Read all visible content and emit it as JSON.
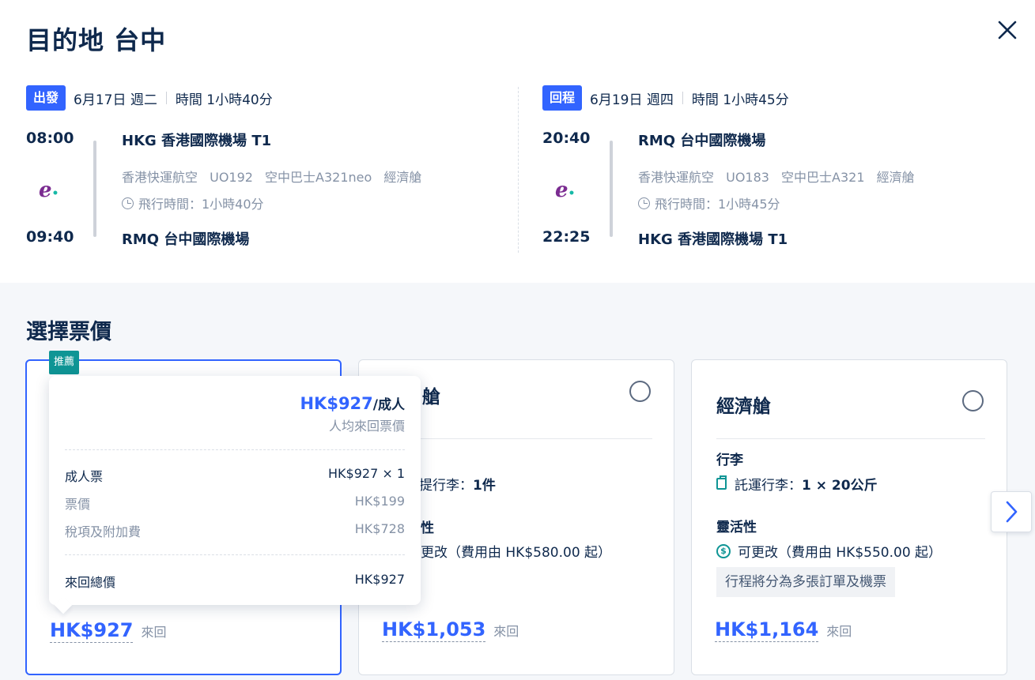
{
  "title": "目的地 台中",
  "outbound": {
    "badge": "出發",
    "date": "6月17日 週二",
    "duration_head": "時間 1小時40分",
    "depart_time": "08:00",
    "arrive_time": "09:40",
    "depart_airport": "HKG 香港國際機場 T1",
    "arrive_airport": "RMQ 台中國際機場",
    "airline": "香港快運航空",
    "flight_no": "UO192",
    "aircraft": "空中巴士A321neo",
    "cabin": "經濟艙",
    "flight_time": "飛行時間：1小時40分"
  },
  "return": {
    "badge": "回程",
    "date": "6月19日 週四",
    "duration_head": "時間 1小時45分",
    "depart_time": "20:40",
    "arrive_time": "22:25",
    "depart_airport": "RMQ 台中國際機場",
    "arrive_airport": "HKG 香港國際機場 T1",
    "airline": "香港快運航空",
    "flight_no": "UO183",
    "aircraft": "空中巴士A321",
    "cabin": "經濟艙",
    "flight_time": "飛行時間：1小時45分"
  },
  "airline_logo_text": "e",
  "fare_section": {
    "title": "選擇票價",
    "cards": [
      {
        "badge": "推薦",
        "price": "HK$927",
        "price_unit": "來回"
      },
      {
        "title_partial": "艙",
        "baggage": "提行李：",
        "baggage_value": "1件",
        "flex_partial": "性",
        "change": "更改（費用由 HK$580.00 起）",
        "price": "HK$1,053",
        "price_unit": "來回"
      },
      {
        "title": "經濟艙",
        "baggage_head": "行李",
        "baggage": "託運行李：",
        "baggage_value": "1 × 20公斤",
        "flex_head": "靈活性",
        "change": "可更改（費用由 HK$550.00 起）",
        "note": "行程將分為多張訂單及機票",
        "price": "HK$1,164",
        "price_unit": "來回"
      }
    ]
  },
  "tooltip": {
    "price": "HK$927",
    "per": "/成人",
    "sub": "人均來回票價",
    "rows": [
      {
        "label": "成人票",
        "value": "HK$927 × 1"
      },
      {
        "label": "票價",
        "value": "HK$199"
      },
      {
        "label": "稅項及附加費",
        "value": "HK$728"
      }
    ],
    "total_label": "來回總價",
    "total_value": "HK$927"
  },
  "colors": {
    "brand_blue": "#3264ff",
    "teal": "#0f9595",
    "text_dark": "#0f294d",
    "text_grey": "#8592a6"
  }
}
